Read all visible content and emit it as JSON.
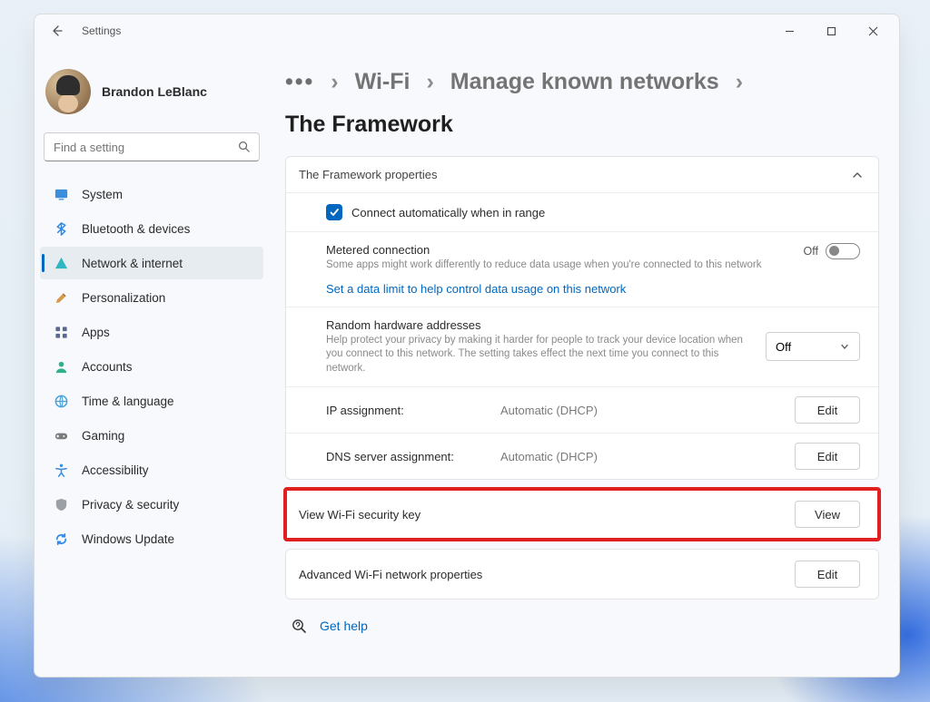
{
  "titlebar": {
    "app_title": "Settings"
  },
  "user": {
    "name": "Brandon LeBlanc"
  },
  "search": {
    "placeholder": "Find a setting"
  },
  "nav": {
    "items": [
      {
        "id": "system",
        "label": "System"
      },
      {
        "id": "bluetooth",
        "label": "Bluetooth & devices"
      },
      {
        "id": "network",
        "label": "Network & internet"
      },
      {
        "id": "personalization",
        "label": "Personalization"
      },
      {
        "id": "apps",
        "label": "Apps"
      },
      {
        "id": "accounts",
        "label": "Accounts"
      },
      {
        "id": "time-language",
        "label": "Time & language"
      },
      {
        "id": "gaming",
        "label": "Gaming"
      },
      {
        "id": "accessibility",
        "label": "Accessibility"
      },
      {
        "id": "privacy",
        "label": "Privacy & security"
      },
      {
        "id": "windows-update",
        "label": "Windows Update"
      }
    ],
    "selected_id": "network"
  },
  "breadcrumb": {
    "overflow": "…",
    "items": [
      "Wi-Fi",
      "Manage known networks"
    ],
    "current": "The Framework"
  },
  "panel": {
    "header": "The Framework properties",
    "auto_connect": {
      "checked": true,
      "label": "Connect automatically when in range"
    },
    "metered": {
      "title": "Metered connection",
      "subtitle": "Some apps might work differently to reduce data usage when you're connected to this network",
      "link": "Set a data limit to help control data usage on this network",
      "toggle_label": "Off"
    },
    "random_mac": {
      "title": "Random hardware addresses",
      "subtitle": "Help protect your privacy by making it harder for people to track your device location when you connect to this network. The setting takes effect the next time you connect to this network.",
      "value": "Off"
    },
    "ip": {
      "label": "IP assignment:",
      "value": "Automatic (DHCP)",
      "button": "Edit"
    },
    "dns": {
      "label": "DNS server assignment:",
      "value": "Automatic (DHCP)",
      "button": "Edit"
    }
  },
  "wifi_key": {
    "label": "View Wi-Fi security key",
    "button": "View"
  },
  "advanced": {
    "label": "Advanced Wi-Fi network properties",
    "button": "Edit"
  },
  "help": {
    "label": "Get help"
  }
}
